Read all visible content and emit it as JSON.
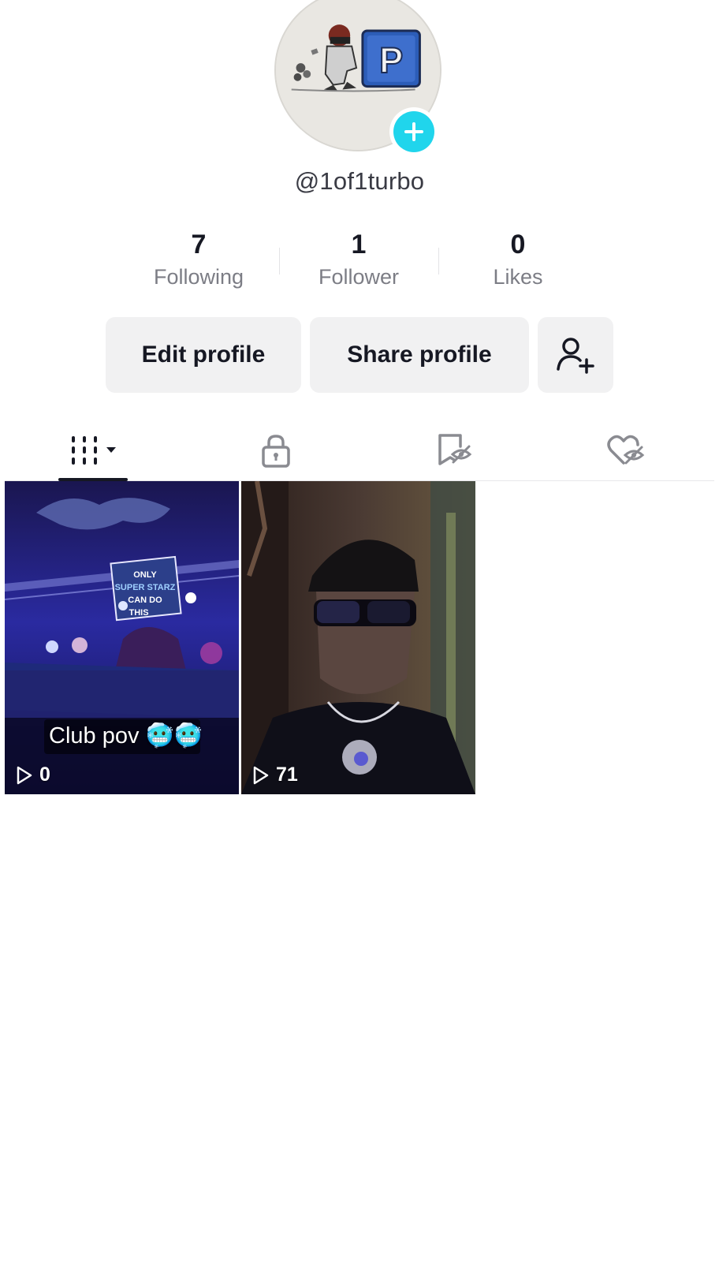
{
  "profile": {
    "username": "@1of1turbo",
    "avatar_icon": "avatar-image",
    "add_icon": "plus-icon",
    "accent_color": "#20d5ec"
  },
  "stats": [
    {
      "value": "7",
      "label": "Following"
    },
    {
      "value": "1",
      "label": "Follower"
    },
    {
      "value": "0",
      "label": "Likes"
    }
  ],
  "actions": {
    "edit_label": "Edit profile",
    "share_label": "Share profile",
    "add_friend_icon": "add-friend-icon"
  },
  "tabs": [
    {
      "icon": "grid-icon",
      "selected": true
    },
    {
      "icon": "lock-icon",
      "selected": false
    },
    {
      "icon": "bookmark-hidden-icon",
      "selected": false
    },
    {
      "icon": "heart-hidden-icon",
      "selected": false
    }
  ],
  "videos": [
    {
      "caption": "Club pov 🥶🥶",
      "views": "0"
    },
    {
      "caption": "",
      "views": "71"
    }
  ]
}
